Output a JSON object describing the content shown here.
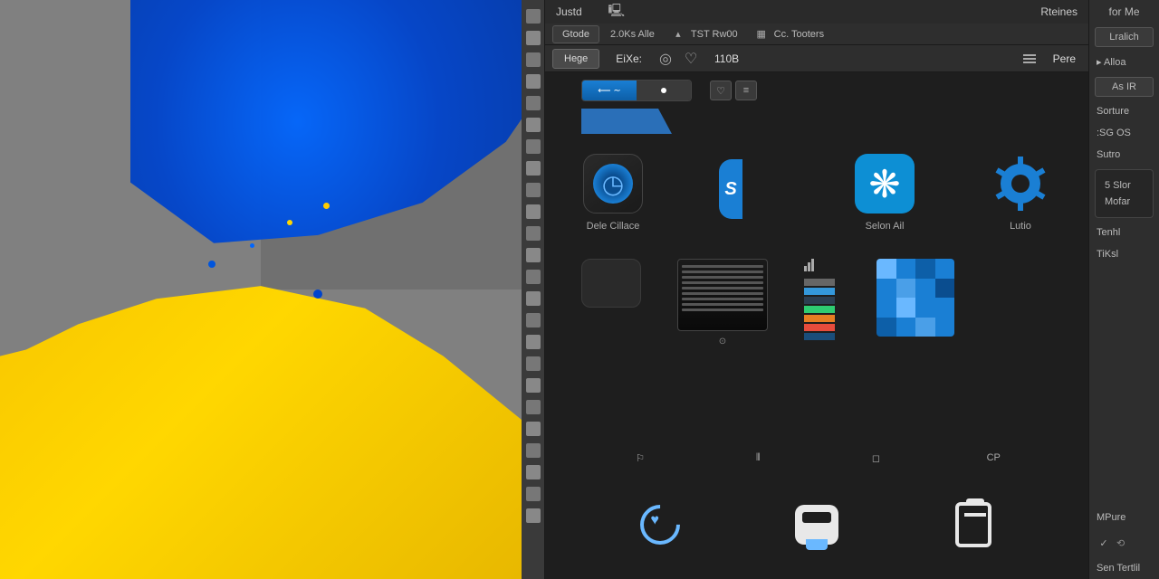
{
  "tabs": {
    "left": "Justd",
    "right": "Rteines"
  },
  "toolbar": {
    "gtode": "Gtode",
    "pct": "2.0Ks Alle",
    "tst": "TST Rw00",
    "cc": "Cc. Tooters",
    "hege": "Hege",
    "eixe": "EiXe:",
    "val110b": "110B",
    "pere": "Pere"
  },
  "gallery": {
    "items": [
      {
        "label": "Dele Cillace"
      },
      {
        "label": ""
      },
      {
        "label": "Selon Ail"
      },
      {
        "label": "Lutio"
      }
    ]
  },
  "bottombar": {
    "cp": "CP"
  },
  "side": {
    "header": "for Me",
    "lralich": "Lralich",
    "alloa": "Alloa",
    "asir": "As IR",
    "sorture": "Sorture",
    "sgos": ":SG OS",
    "sutro": "Sutro",
    "box": {
      "line1": "5 Slor",
      "line2": "Mofar"
    },
    "tenhl": "Tenhl",
    "tiksl": "TiKsl",
    "mpure": "MPure",
    "sentertil": "Sen Tertlil"
  },
  "icons": {
    "folder_s": "S"
  }
}
